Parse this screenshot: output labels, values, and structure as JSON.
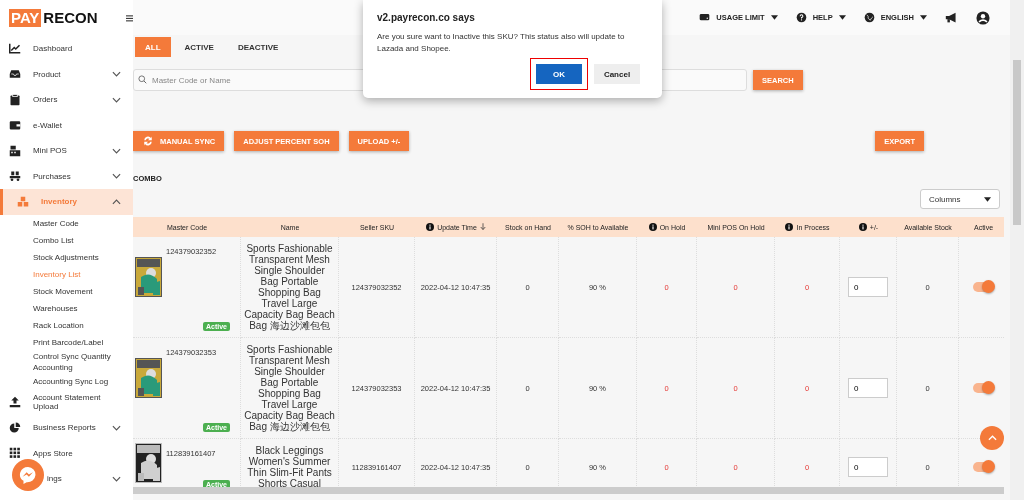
{
  "logo": {
    "part_1": "PAY",
    "part_2": "RECON"
  },
  "topbar": {
    "items": [
      {
        "label": "USAGE LIMIT"
      },
      {
        "label": "HELP"
      },
      {
        "label": "ENGLISH"
      }
    ]
  },
  "sidebar": {
    "items": [
      {
        "label": "Dashboard",
        "expandable": false,
        "expanded": false,
        "selected": false
      },
      {
        "label": "Product",
        "expandable": true,
        "expanded": false,
        "selected": false
      },
      {
        "label": "Orders",
        "expandable": true,
        "expanded": false,
        "selected": false
      },
      {
        "label": "e-Wallet",
        "expandable": false,
        "expanded": false,
        "selected": false
      },
      {
        "label": "Mini POS",
        "expandable": true,
        "expanded": false,
        "selected": false
      },
      {
        "label": "Purchases",
        "expandable": true,
        "expanded": false,
        "selected": false
      },
      {
        "label": "Inventory",
        "expandable": true,
        "expanded": true,
        "selected": true,
        "children": [
          {
            "label": "Master Code",
            "selected": false
          },
          {
            "label": "Combo List",
            "selected": false
          },
          {
            "label": "Stock Adjustments",
            "selected": false
          },
          {
            "label": "Inventory List",
            "selected": true
          },
          {
            "label": "Stock Movement",
            "selected": false
          },
          {
            "label": "Warehouses",
            "selected": false
          },
          {
            "label": "Rack Location",
            "selected": false
          },
          {
            "label": "Print Barcode/Label",
            "selected": false
          },
          {
            "label": "Control Sync Quantity Accounting",
            "selected": false
          },
          {
            "label": "Accounting Sync Log",
            "selected": false
          }
        ]
      },
      {
        "label": "Account Statement Upload",
        "expandable": false,
        "expanded": false,
        "selected": false
      },
      {
        "label": "Business Reports",
        "expandable": true,
        "expanded": false,
        "selected": false
      },
      {
        "label": "Apps Store",
        "expandable": false,
        "expanded": false,
        "selected": false
      },
      {
        "label": "ings",
        "expandable": true,
        "expanded": false,
        "selected": false
      }
    ]
  },
  "filter_tabs": [
    {
      "label": "ALL",
      "selected": true
    },
    {
      "label": "ACTIVE",
      "selected": false
    },
    {
      "label": "DEACTIVE",
      "selected": false
    }
  ],
  "search": {
    "placeholder": "Master Code or Name",
    "button": "SEARCH"
  },
  "actions": [
    {
      "label": "MANUAL SYNC",
      "kind": "sync"
    },
    {
      "label": "ADJUST PERCENT SOH",
      "kind": "plain"
    },
    {
      "label": "UPLOAD +/-",
      "kind": "plain"
    }
  ],
  "export_button": "EXPORT",
  "section_label": "COMBO",
  "columns_select": "Columns",
  "table": {
    "columns": [
      {
        "label": "Master Code",
        "info": false,
        "sorted": false
      },
      {
        "label": "Name",
        "info": false,
        "sorted": false
      },
      {
        "label": "Seller SKU",
        "info": false,
        "sorted": false
      },
      {
        "label": "Update Time",
        "info": true,
        "sorted": true
      },
      {
        "label": "Stock on Hand",
        "info": false,
        "sorted": false
      },
      {
        "label": "% SOH to Available",
        "info": false,
        "sorted": false
      },
      {
        "label": "On Hold",
        "info": true,
        "sorted": false
      },
      {
        "label": "Mini POS On Hold",
        "info": false,
        "sorted": false
      },
      {
        "label": "In Process",
        "info": true,
        "sorted": false
      },
      {
        "label": "+/-",
        "info": true,
        "sorted": false
      },
      {
        "label": "Available Stock",
        "info": false,
        "sorted": false
      },
      {
        "label": "Active",
        "info": false,
        "sorted": false
      }
    ],
    "rows": [
      {
        "master_code": "124379032352",
        "status": "Active",
        "name": "Sports Fashionable Transparent Mesh Single Shoulder Bag Portable Shopping Bag Travel Large Capacity Bag Beach Bag 海边沙滩包包",
        "seller_sku": "124379032352",
        "update_time": "2022-04-12 10:47:35",
        "stock_on_hand": "0",
        "soh_to_available": "90 %",
        "on_hold": "0",
        "mini_pos_on_hold": "0",
        "in_process": "0",
        "adjust": "0",
        "available_stock": "0",
        "active": true
      },
      {
        "master_code": "124379032353",
        "status": "Active",
        "name": "Sports Fashionable Transparent Mesh Single Shoulder Bag Portable Shopping Bag Travel Large Capacity Bag Beach Bag 海边沙滩包包",
        "seller_sku": "124379032353",
        "update_time": "2022-04-12 10:47:35",
        "stock_on_hand": "0",
        "soh_to_available": "90 %",
        "on_hold": "0",
        "mini_pos_on_hold": "0",
        "in_process": "0",
        "adjust": "0",
        "available_stock": "0",
        "active": true
      },
      {
        "master_code": "112839161407",
        "status": "Active",
        "name": "Black Leggings Women's Summer Thin Slim-Fit Pants Shorts Casual",
        "seller_sku": "112839161407",
        "update_time": "2022-04-12 10:47:35",
        "stock_on_hand": "0",
        "soh_to_available": "90 %",
        "on_hold": "0",
        "mini_pos_on_hold": "0",
        "in_process": "0",
        "adjust": "0",
        "available_stock": "0",
        "active": true
      }
    ]
  },
  "dialog": {
    "title": "v2.payrecon.co says",
    "message": "Are you sure want to Inactive this SKU? This status also will update to Lazada and Shopee.",
    "buttons": [
      {
        "label": "OK",
        "primary": true,
        "highlighted": true
      },
      {
        "label": "Cancel",
        "primary": false,
        "highlighted": false
      }
    ]
  }
}
